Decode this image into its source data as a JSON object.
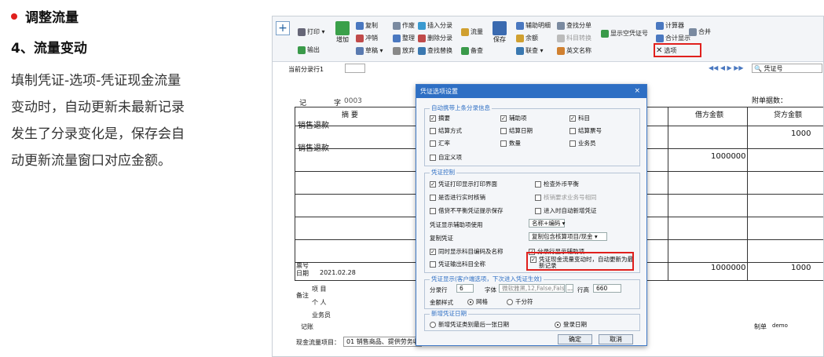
{
  "article": {
    "section_title": "调整流量",
    "subtitle": "4、流量变动",
    "paragraph_lines": [
      "填制凭证-选项-凭证现金流量",
      "变动时，自动更新未最新记录",
      "发生了分录变化是，保存会自",
      "动更新流量窗口对应金额。"
    ]
  },
  "toolbar": {
    "print": "打印 ▾",
    "export": "输出",
    "add": "增加",
    "draft": "草稿 ▾",
    "copy": "复制",
    "red_reverse": "冲销",
    "tidy": "整理",
    "release": "放弃",
    "void": "作废",
    "delete_entry": "删除分录",
    "insert_entry": "插入分录",
    "find_replace": "查找替换",
    "flow": "流量",
    "review": "备查",
    "save": "保存",
    "aux_detail": "辅助明细",
    "balance": "余额",
    "link_query": "联查 ▾",
    "find_entry": "查找分单",
    "subject_convert": "科目转换",
    "english_name": "英文名称",
    "show_empty_voucher": "显示空凭证号",
    "calculator": "计算器",
    "merge": "合并",
    "merge_show": "合计显示",
    "options": "选项"
  },
  "nav": {
    "current_row": "当前分录行1",
    "voucher_no_label": "凭证号",
    "attachments": "附单据数："
  },
  "voucher": {
    "word_label": "记",
    "word_no_label": "字",
    "word_no": "0003",
    "summary_header": "摘 要",
    "debit_header": "借方金额",
    "credit_header": "贷方金额",
    "row1_summary": "销售退款",
    "row2_summary": "销售退款",
    "row2_debit": "1000000",
    "row1_credit": "1000",
    "total_debit": "1000000",
    "total_credit": "1000",
    "bill_no_label": "票号",
    "date_label": "日期",
    "date_value": "2021.02.28",
    "remark_label": "备注",
    "project_label": "项 目",
    "person_label": "个 人",
    "salesperson_label": "业务员",
    "bookkeep_label": "记账",
    "maker_label": "制单",
    "maker_value": "demo",
    "cashflow_label": "现金流量项目：",
    "cashflow_value": "01 销售商品、提供劳务收"
  },
  "dialog": {
    "title": "凭证选项设置",
    "close": "×",
    "group1_title": "自动携带上条分录信息",
    "g1": [
      {
        "label": "摘要",
        "checked": true
      },
      {
        "label": "辅助项",
        "checked": true
      },
      {
        "label": "科目",
        "checked": true
      },
      {
        "label": "结算方式",
        "checked": false
      },
      {
        "label": "结算日期",
        "checked": false
      },
      {
        "label": "结算票号",
        "checked": false
      },
      {
        "label": "汇率",
        "checked": false
      },
      {
        "label": "数量",
        "checked": false
      },
      {
        "label": "业务员",
        "checked": false
      },
      {
        "label": "自定义项",
        "checked": false
      }
    ],
    "group2_title": "凭证控制",
    "g2": [
      {
        "label": "凭证打印显示打印界面",
        "checked": true
      },
      {
        "label": "检查外币平衡",
        "checked": false
      },
      {
        "label": "是否进行实时核销",
        "checked": false
      },
      {
        "label": "核销要求业务号相同",
        "checked": false,
        "disabled": true
      },
      {
        "label": "借贷不平衡凭证提示保存",
        "checked": false
      },
      {
        "label": "进入时自动新增凭证",
        "checked": false
      }
    ],
    "aux_display_label": "凭证显示辅助项使用",
    "aux_display_value": "名称+编码 ▾",
    "copy_voucher_label": "复制凭证",
    "copy_voucher_value": "复制包含核算项目/现金 ▾",
    "show_code_name": "同时显示科目编码及名称",
    "show_code_name_checked": true,
    "line_show_aux": "分录行显示辅助项",
    "line_show_aux_checked": true,
    "output_full_name": "凭证输出科目全称",
    "output_full_name_checked": false,
    "cashflow_update": "凭证现金流量变动时，自动更新为最新记录",
    "cashflow_update_checked": true,
    "group3_title": "凭证显示(客户端选项，下次进入凭证生效)",
    "line_count_label": "分录行",
    "line_count_value": "6",
    "font_label": "字体",
    "font_value": "微软雅黑,12,False,Fals",
    "font_btn": "...",
    "row_height_label": "行高",
    "row_height_value": "660",
    "amount_style_label": "金额样式",
    "grid_label": "网格",
    "thousands_label": "千分符",
    "group4_title": "新增凭证日期",
    "date_last_label": "新增凭证类别最后一张日期",
    "date_login_label": "登录日期",
    "ok": "确定",
    "cancel": "取消"
  }
}
